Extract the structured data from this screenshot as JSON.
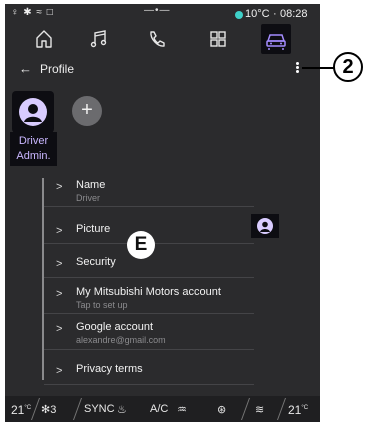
{
  "status_bar": {
    "left_icons": "♀ ✱ ≈ □",
    "page_indicator": "—•—",
    "temperature": "10°C",
    "separator": "·",
    "time": "08:28",
    "accent_color": "#3fd0c8"
  },
  "nav": {
    "items": [
      {
        "icon": "home-icon"
      },
      {
        "icon": "music-icon"
      },
      {
        "icon": "phone-icon"
      },
      {
        "icon": "apps-icon"
      },
      {
        "icon": "vehicle-icon",
        "active": true
      }
    ]
  },
  "header": {
    "back": "←",
    "title": "Profile"
  },
  "profile": {
    "label_line1": "Driver",
    "label_line2": "Admin.",
    "add": "+"
  },
  "settings": {
    "items": [
      {
        "title": "Name",
        "subtitle": "Driver"
      },
      {
        "title": "Picture",
        "subtitle": ""
      },
      {
        "title": "Security",
        "subtitle": ""
      },
      {
        "title": "My Mitsubishi Motors account",
        "subtitle": "Tap to set up"
      },
      {
        "title": "Google account",
        "subtitle": "alexandre@gmail.com"
      },
      {
        "title": "Privacy terms",
        "subtitle": ""
      }
    ],
    "chevron": ">"
  },
  "callouts": {
    "e": "E",
    "two": "2"
  },
  "climate": {
    "temp_left": "21",
    "temp_right": "21",
    "unit": "°C",
    "fan_level": "3",
    "sync": "SYNC",
    "ac": "A/C"
  },
  "colors": {
    "screen_bg": "#2b2b2d",
    "highlight_bg": "#0d0d12",
    "accent_text": "#c9b6ff"
  }
}
